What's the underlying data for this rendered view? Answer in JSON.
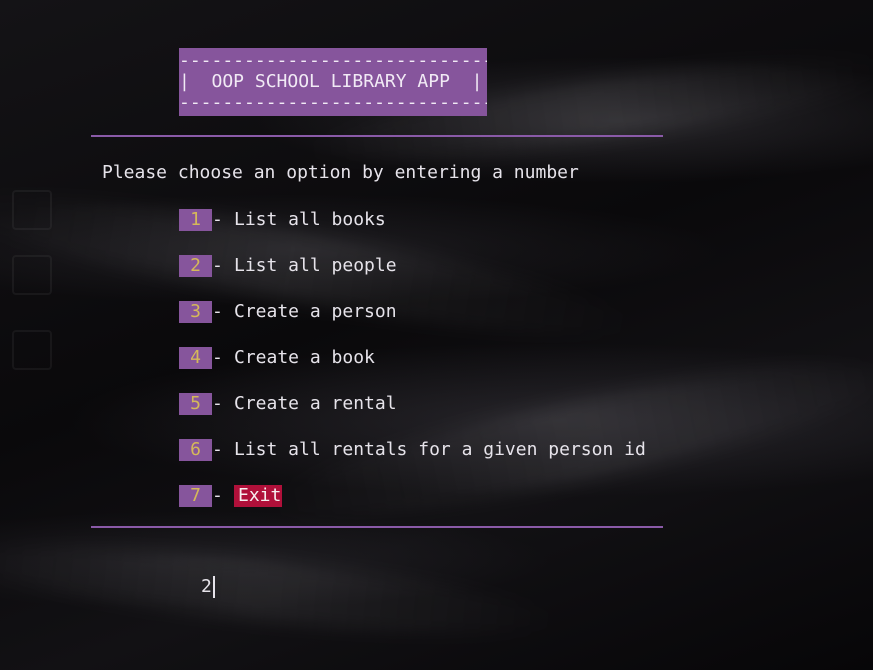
{
  "banner": {
    "top_border": "-----------------------------",
    "title_line": "|  OOP SCHOOL LIBRARY APP  |",
    "bottom_border": "-----------------------------"
  },
  "prompt": "Please choose an option by entering a number",
  "menu": {
    "separator": "- ",
    "items": [
      {
        "number": "1",
        "label": "List all books"
      },
      {
        "number": "2",
        "label": "List all people"
      },
      {
        "number": "3",
        "label": "Create a person"
      },
      {
        "number": "4",
        "label": "Create a book"
      },
      {
        "number": "5",
        "label": "Create a rental"
      },
      {
        "number": "6",
        "label": "List all rentals for a given person id"
      },
      {
        "number": "7",
        "label": "Exit"
      }
    ]
  },
  "input": {
    "value": "2"
  },
  "colors": {
    "banner_bg": "#86559c",
    "number_text": "#d5b85a",
    "exit_bg": "#b0103a",
    "separator_line": "#8a5aa8"
  }
}
